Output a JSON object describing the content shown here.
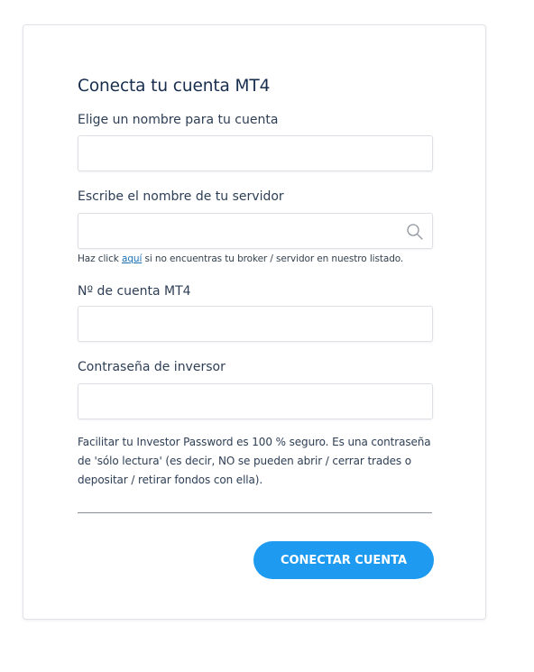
{
  "form": {
    "title": "Conecta tu cuenta MT4",
    "account_name": {
      "label": "Elige un nombre para tu cuenta",
      "value": "",
      "placeholder": ""
    },
    "server": {
      "label": "Escribe el nombre de tu servidor",
      "value": "",
      "placeholder": "",
      "icon": "search-icon"
    },
    "hint": {
      "prefix": "Haz click ",
      "link": "aquí",
      "suffix": " si no encuentras tu broker / servidor en nuestro listado."
    },
    "account_number": {
      "label": "Nº de cuenta MT4",
      "value": "",
      "placeholder": ""
    },
    "investor_password": {
      "label": "Contraseña de inversor",
      "value": "",
      "placeholder": ""
    },
    "note": "Facilitar tu Investor Password es 100 % seguro. Es una contraseña de 'sólo lectura' (es decir, NO se pueden abrir / cerrar trades o depositar / retirar fondos con ella).",
    "submit_label": "CONECTAR CUENTA"
  },
  "colors": {
    "title": "#162d4d",
    "text": "#2d3e55",
    "link": "#1a6fb5",
    "button": "#1e9bf0",
    "border": "#dcdfe4"
  }
}
